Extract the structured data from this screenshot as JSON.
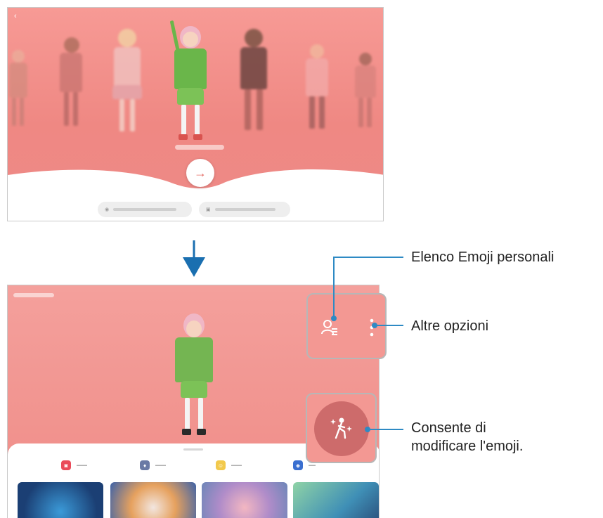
{
  "arrow_color": "#1a6fb0",
  "accent_color": "#ef8883",
  "callout_line_color": "#2e8ac4",
  "callouts": {
    "emoji_list": "Elenco Emoji personali",
    "more_options": "Altre opzioni",
    "edit_emoji_line1": "Consente di",
    "edit_emoji_line2": "modificare l'emoji."
  },
  "top_screen": {
    "next_icon": "arrow-right-icon",
    "back_icon": "chevron-left-icon",
    "pill_camera_icon": "camera-icon",
    "pill_image_icon": "image-icon"
  },
  "bottom_screen": {
    "list_icon": "person-list-icon",
    "more_icon": "more-vertical-icon",
    "edit_icon": "person-sparkle-icon",
    "categories": [
      {
        "icon": "camera-icon",
        "color": "#ea4b5a"
      },
      {
        "icon": "sticker-icon",
        "color": "#6a7aa5"
      },
      {
        "icon": "emoji-face-icon",
        "color": "#f2c94c"
      },
      {
        "icon": "studio-icon",
        "color": "#3a6fd0"
      }
    ]
  }
}
